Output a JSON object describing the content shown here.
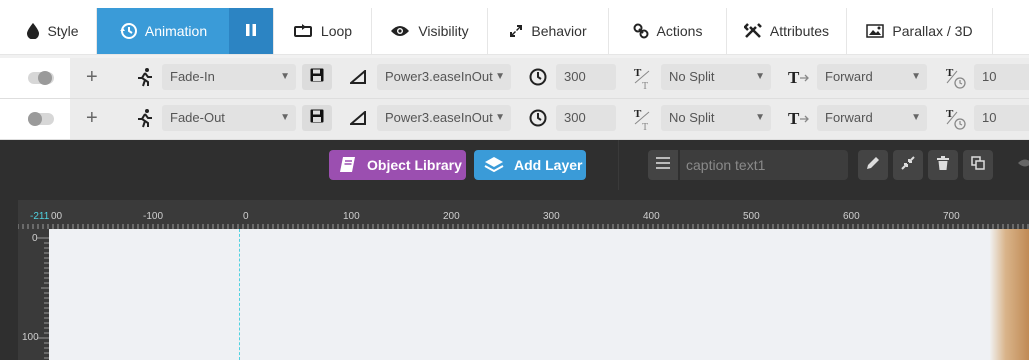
{
  "tabs": [
    {
      "label": "Style",
      "icon": "drop-icon"
    },
    {
      "label": "Animation",
      "icon": "history-icon",
      "active": true
    },
    {
      "label": "Loop",
      "icon": "loop-icon"
    },
    {
      "label": "Visibility",
      "icon": "eye-icon"
    },
    {
      "label": "Behavior",
      "icon": "resize-icon"
    },
    {
      "label": "Actions",
      "icon": "link-icon"
    },
    {
      "label": "Attributes",
      "icon": "tools-icon"
    },
    {
      "label": "Parallax / 3D",
      "icon": "image-icon"
    }
  ],
  "rows": [
    {
      "animation": "Fade-In",
      "easing": "Power3.easeInOut",
      "duration": "300",
      "split": "No Split",
      "direction": "Forward",
      "split_delay": "10"
    },
    {
      "animation": "Fade-Out",
      "easing": "Power3.easeInOut",
      "duration": "300",
      "split": "No Split",
      "direction": "Forward",
      "split_delay": "10"
    }
  ],
  "toolbar": {
    "object_library": "Object Library",
    "add_layer": "Add Layer",
    "caption_value": "caption text1"
  },
  "ruler": {
    "top_labels": [
      "-211",
      "00",
      "-100",
      "0",
      "100",
      "200",
      "300",
      "400",
      "500",
      "600",
      "700"
    ],
    "left_labels": [
      "0",
      "100"
    ]
  },
  "colors": {
    "accent": "#3a9bd8",
    "purple": "#9b4fb0",
    "guide": "#4fd2e0"
  }
}
